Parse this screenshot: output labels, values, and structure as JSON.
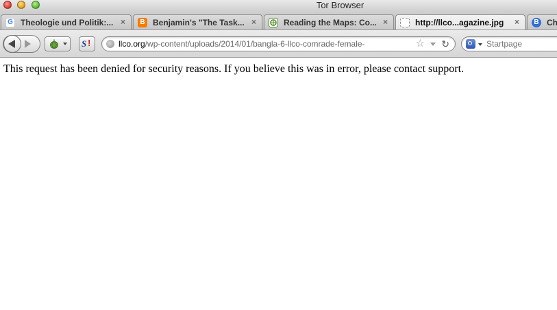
{
  "window": {
    "title": "Tor Browser"
  },
  "tabs": [
    {
      "label": "Theologie und Politik:...",
      "icon": "google-icon",
      "active": false
    },
    {
      "label": "Benjamin's \"The Task...",
      "icon": "blogger-icon",
      "active": false
    },
    {
      "label": "Reading the Maps: Co...",
      "icon": "globe-emblem-icon",
      "active": false
    },
    {
      "label": "http://llco...agazine.jpg",
      "icon": "blank-page-icon",
      "active": true
    },
    {
      "label": "Ch",
      "icon": "blue-b-icon",
      "active": false
    }
  ],
  "tab_close_glyph": "×",
  "navbar": {
    "url_host": "llco.org",
    "url_path": "/wp-content/uploads/2014/01/bangla-6-llco-comrade-female-",
    "search_placeholder": "Startpage"
  },
  "content": {
    "message": "This request has been denied for security reasons. If you believe this was in error, please contact support."
  },
  "colors": {
    "blogger": "#f57d00",
    "google_blue": "#4285f4",
    "tor_green": "#4e8b2b"
  }
}
